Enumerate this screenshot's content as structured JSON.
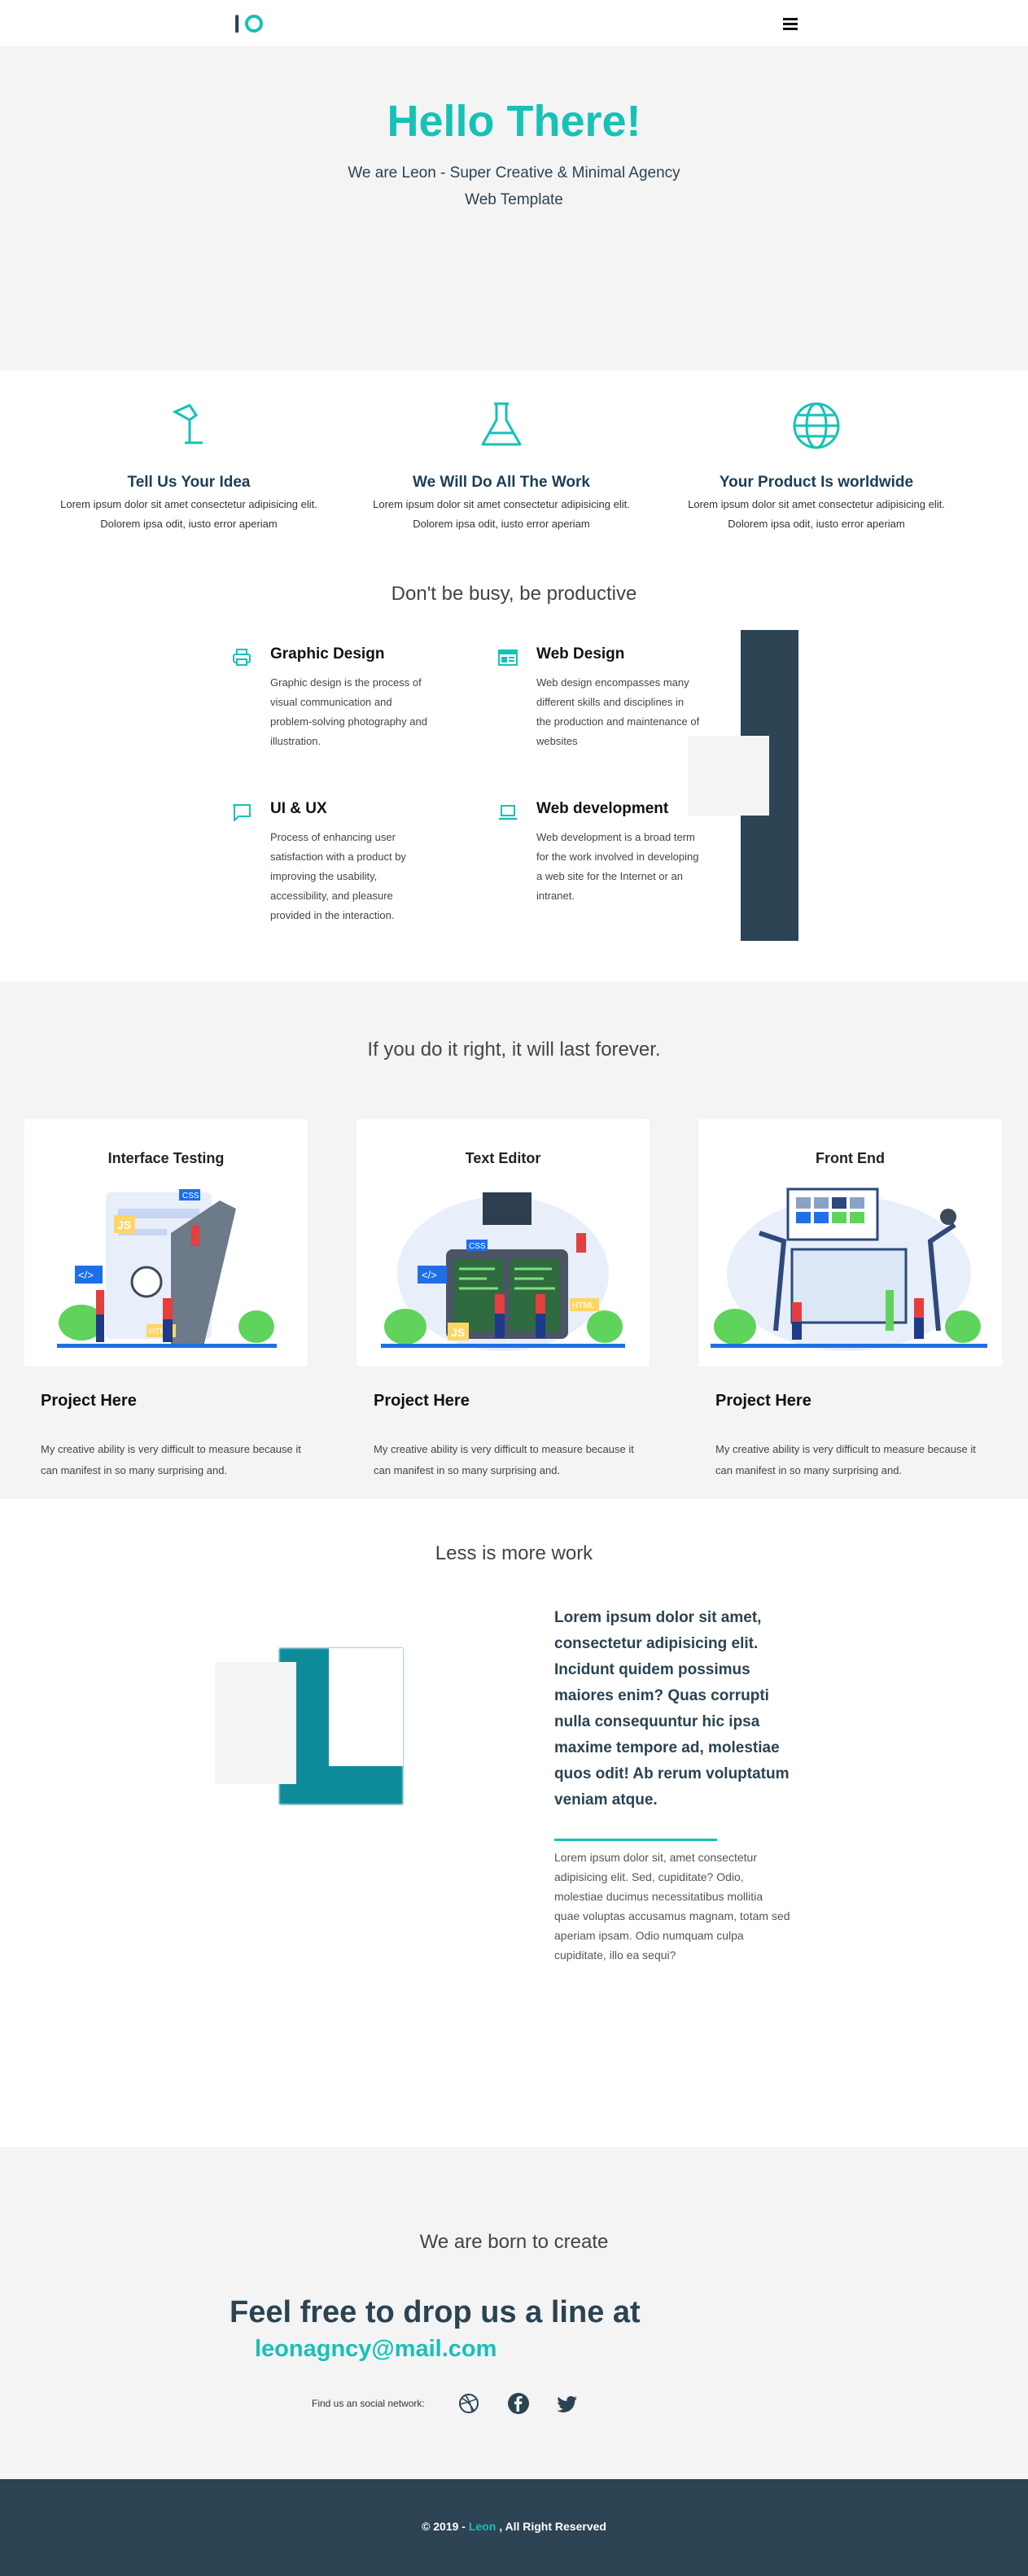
{
  "nav": {
    "logo_letter": "l",
    "menu_icon": "hamburger-icon"
  },
  "hero": {
    "title": "Hello There!",
    "subtitle_line1": "We are Leon - Super Creative & Minimal Agency",
    "subtitle_line2": "Web Template"
  },
  "features": [
    {
      "icon": "lamp-icon",
      "title": "Tell Us Your Idea",
      "line1": "Lorem ipsum dolor sit amet consectetur adipisicing elit.",
      "line2": "Dolorem ipsa odit, iusto error aperiam"
    },
    {
      "icon": "flask-icon",
      "title": "We Will Do All The Work",
      "line1": "Lorem ipsum dolor sit amet consectetur adipisicing elit.",
      "line2": "Dolorem ipsa odit, iusto error aperiam"
    },
    {
      "icon": "globe-icon",
      "title": "Your Product Is worldwide",
      "line1": "Lorem ipsum dolor sit amet consectetur adipisicing elit.",
      "line2": "Dolorem ipsa odit, iusto error aperiam"
    }
  ],
  "services_title": "Don't be busy, be productive",
  "services": [
    {
      "icon": "printer-icon",
      "title": "Graphic Design",
      "text": "Graphic design is the process of visual communication and problem-solving photography and illustration."
    },
    {
      "icon": "layout-icon",
      "title": "Web Design",
      "text": "Web design encompasses many different skills and disciplines in the production and maintenance of websites"
    },
    {
      "icon": "chat-icon",
      "title": "UI & UX",
      "text": "Process of enhancing user satisfaction with a product by improving the usability, accessibility, and pleasure provided in the interaction."
    },
    {
      "icon": "laptop-icon",
      "title": "Web development",
      "text": "Web development is a broad term for the work involved in developing a web site for the Internet or an intranet."
    }
  ],
  "projects_title": "If you do it right, it will last forever.",
  "projects": [
    {
      "card_title": "Interface Testing",
      "title": "Project Here",
      "text": "My creative ability is very difficult to measure because it can manifest in so many surprising and.",
      "tags": [
        "JS",
        "CSS",
        "HTML"
      ]
    },
    {
      "card_title": "Text Editor",
      "title": "Project Here",
      "text": "My creative ability is very difficult to measure because it can manifest in so many surprising and.",
      "tags": [
        "JS",
        "CSS",
        "HTML"
      ]
    },
    {
      "card_title": "Front End",
      "title": "Project Here",
      "text": "My creative ability is very difficult to measure because it can manifest in so many surprising and.",
      "tags": []
    }
  ],
  "about": {
    "title": "Less is more work",
    "heading": "Lorem ipsum dolor sit amet, consectetur adipisicing elit. Incidunt quidem possimus maiores enim? Quas corrupti nulla consequuntur hic ipsa maxime tempore ad, molestiae quos odit! Ab rerum voluptatum veniam atque.",
    "body": "Lorem ipsum dolor sit, amet consectetur adipisicing elit. Sed, cupiditate? Odio, molestiae ducimus necessitatibus mollitia quae voluptas accusamus magnam, totam sed aperiam ipsam. Odio numquam culpa cupiditate, illo ea sequi?"
  },
  "contact": {
    "title": "We are born to create",
    "heading": "Feel free to drop us a line at",
    "email": "leonagncy@mail.com",
    "social_label": "Find us an social network:",
    "social_icons": [
      "dribbble-icon",
      "facebook-icon",
      "twitter-icon"
    ]
  },
  "footer": {
    "prefix": "© 2019 - ",
    "brand": "Leon",
    "suffix": " , All Right Reserved"
  },
  "colors": {
    "accent": "#17c1b6",
    "dark": "#2c4454",
    "band": "#f4f4f4"
  }
}
